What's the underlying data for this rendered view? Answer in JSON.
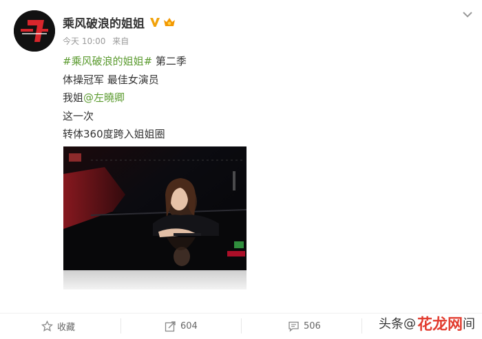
{
  "post": {
    "author": "乘风破浪的姐姐",
    "meta": {
      "time": "今天 10:00",
      "source": "来自"
    },
    "lines": {
      "topic": "#乘风破浪的姐姐#",
      "topic_suffix": " 第二季",
      "line2": "体操冠军 最佳女演员",
      "line3_prefix": "我姐",
      "mention": "@左曉卿",
      "line4": "这一次",
      "line5": "转体360度跨入姐姐圈"
    }
  },
  "actions": {
    "favorite_label": "收藏",
    "repost_count": "604",
    "comment_count": "506",
    "like_label": "间"
  },
  "watermark": {
    "prefix": "头条",
    "at": "@",
    "brand": "花龙网"
  },
  "icons": {
    "avatar": "show-logo-avatar",
    "verified": "verified-v-icon",
    "vip": "vip-badge-icon",
    "menu": "chevron-down-icon",
    "favorite": "star-icon",
    "repost": "share-icon",
    "comment": "comment-icon"
  },
  "colors": {
    "link": "#5a9a2e",
    "verified": "#f1a20b",
    "brand": "#e23b2e"
  }
}
